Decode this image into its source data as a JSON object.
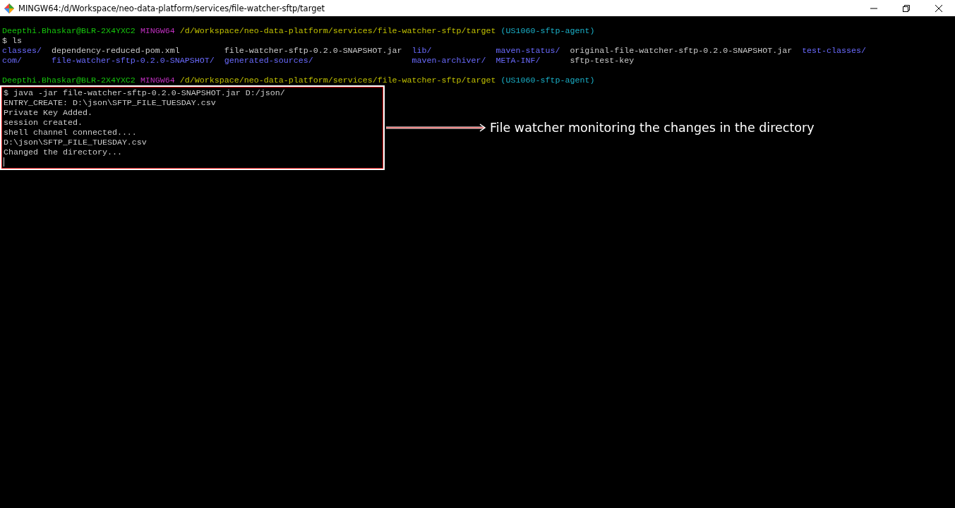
{
  "window": {
    "title": "MINGW64:/d/Workspace/neo-data-platform/services/file-watcher-sftp/target"
  },
  "terminal": {
    "blocks": [
      {
        "kind": "prompt",
        "user_host": "Deepthi.Bhaskar@BLR-2X4YXC2",
        "shell": "MINGW64",
        "path": "/d/Workspace/neo-data-platform/services/file-watcher-sftp/target",
        "branch": "(US1060-sftp-agent)"
      },
      {
        "kind": "command",
        "text": "$ ls"
      },
      {
        "kind": "listing",
        "rows": [
          [
            {
              "name": "classes/",
              "directory": true
            },
            {
              "name": "dependency-reduced-pom.xml",
              "directory": false
            },
            {
              "name": "file-watcher-sftp-0.2.0-SNAPSHOT.jar",
              "directory": false
            },
            {
              "name": "lib/",
              "directory": true
            },
            {
              "name": "maven-status/",
              "directory": true
            },
            {
              "name": "original-file-watcher-sftp-0.2.0-SNAPSHOT.jar",
              "directory": false
            },
            {
              "name": "test-classes/",
              "directory": true
            }
          ],
          [
            {
              "name": "com/",
              "directory": true
            },
            {
              "name": "file-watcher-sftp-0.2.0-SNAPSHOT/",
              "directory": true
            },
            {
              "name": "generated-sources/",
              "directory": true
            },
            {
              "name": "maven-archiver/",
              "directory": true
            },
            {
              "name": "META-INF/",
              "directory": true
            },
            {
              "name": "sftp-test-key",
              "directory": false
            }
          ]
        ]
      },
      {
        "kind": "prompt",
        "user_host": "Deepthi.Bhaskar@BLR-2X4YXC2",
        "shell": "MINGW64",
        "path": "/d/Workspace/neo-data-platform/services/file-watcher-sftp/target",
        "branch": "(US1060-sftp-agent)"
      }
    ],
    "highlighted_output": {
      "lines": [
        "$ java -jar file-watcher-sftp-0.2.0-SNAPSHOT.jar D:/json/",
        "ENTRY_CREATE: D:\\json\\SFTP_FILE_TUESDAY.csv",
        "Private Key Added.",
        "session created.",
        "shell channel connected....",
        "D:\\json\\SFTP_FILE_TUESDAY.csv",
        "Changed the directory..."
      ],
      "cursor": true
    }
  },
  "annotation": {
    "text": "File watcher monitoring the changes in the directory"
  }
}
